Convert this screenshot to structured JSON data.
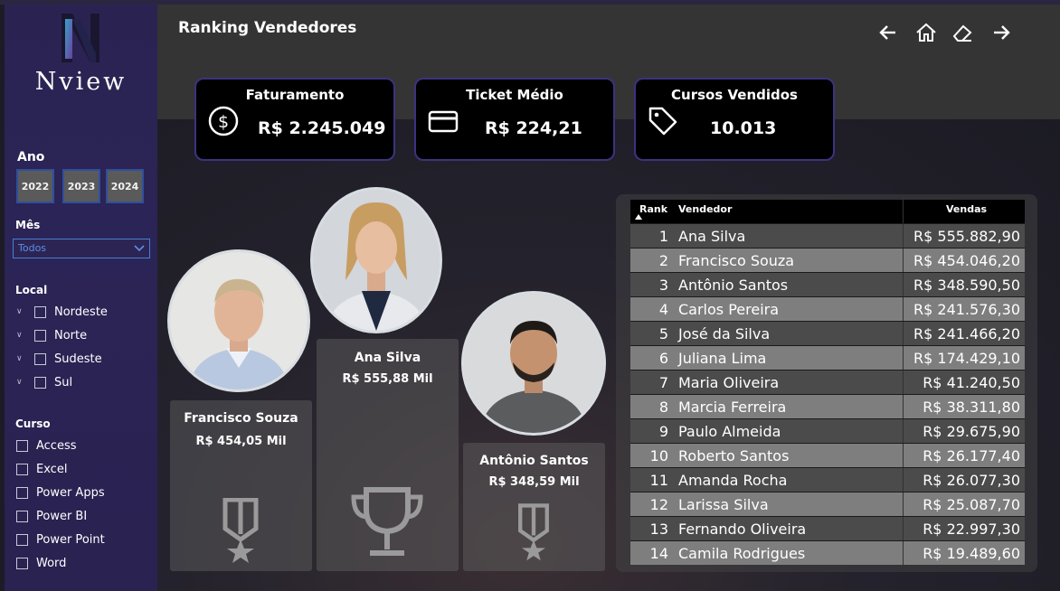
{
  "brand": {
    "name": "Nview"
  },
  "page_title": "Ranking Vendedores",
  "filters": {
    "ano_label": "Ano",
    "years": [
      "2022",
      "2023",
      "2024"
    ],
    "mes_label": "Mês",
    "mes_selected": "Todos",
    "local_label": "Local",
    "locais": [
      "Nordeste",
      "Norte",
      "Sudeste",
      "Sul"
    ],
    "curso_label": "Curso",
    "cursos": [
      "Access",
      "Excel",
      "Power Apps",
      "Power BI",
      "Power Point",
      "Word"
    ]
  },
  "nav_icons": [
    "back-arrow-icon",
    "home-icon",
    "eraser-icon",
    "forward-arrow-icon"
  ],
  "kpis": [
    {
      "title": "Faturamento",
      "value": "R$ 2.245.049",
      "icon": "dollar-circle-icon"
    },
    {
      "title": "Ticket Médio",
      "value": "R$ 224,21",
      "icon": "credit-card-icon"
    },
    {
      "title": "Cursos Vendidos",
      "value": "10.013",
      "icon": "tag-icon"
    }
  ],
  "podium": {
    "first": {
      "name": "Ana Silva",
      "value": "R$ 555,88 Mil",
      "icon": "trophy-icon"
    },
    "second": {
      "name": "Francisco Souza",
      "value": "R$ 454,05 Mil",
      "icon": "medal-icon"
    },
    "third": {
      "name": "Antônio Santos",
      "value": "R$ 348,59 Mil",
      "icon": "medal-icon"
    }
  },
  "table": {
    "headers": {
      "rank": "Rank",
      "vendedor": "Vendedor",
      "vendas": "Vendas"
    },
    "rows": [
      {
        "rank": "1",
        "vendedor": "Ana Silva",
        "vendas": "R$ 555.882,90"
      },
      {
        "rank": "2",
        "vendedor": "Francisco Souza",
        "vendas": "R$ 454.046,20"
      },
      {
        "rank": "3",
        "vendedor": "Antônio Santos",
        "vendas": "R$ 348.590,50"
      },
      {
        "rank": "4",
        "vendedor": "Carlos Pereira",
        "vendas": "R$ 241.576,30"
      },
      {
        "rank": "5",
        "vendedor": "José da Silva",
        "vendas": "R$ 241.466,20"
      },
      {
        "rank": "6",
        "vendedor": "Juliana Lima",
        "vendas": "R$ 174.429,10"
      },
      {
        "rank": "7",
        "vendedor": "Maria Oliveira",
        "vendas": "R$ 41.240,50"
      },
      {
        "rank": "8",
        "vendedor": "Marcia Ferreira",
        "vendas": "R$ 38.311,80"
      },
      {
        "rank": "9",
        "vendedor": "Paulo Almeida",
        "vendas": "R$ 29.675,90"
      },
      {
        "rank": "10",
        "vendedor": "Roberto Santos",
        "vendas": "R$ 26.177,40"
      },
      {
        "rank": "11",
        "vendedor": "Amanda Rocha",
        "vendas": "R$ 26.077,30"
      },
      {
        "rank": "12",
        "vendedor": "Larissa Silva",
        "vendas": "R$ 25.087,70"
      },
      {
        "rank": "13",
        "vendedor": "Fernando Oliveira",
        "vendas": "R$ 22.997,30"
      },
      {
        "rank": "14",
        "vendedor": "Camila Rodrigues",
        "vendas": "R$ 19.489,60"
      }
    ]
  },
  "colors": {
    "sidebar": "#2a2352",
    "accent_border": "#3b3380",
    "header": "#343434",
    "row_dark": "#4b4b4b",
    "row_light": "#7e7e7e"
  }
}
